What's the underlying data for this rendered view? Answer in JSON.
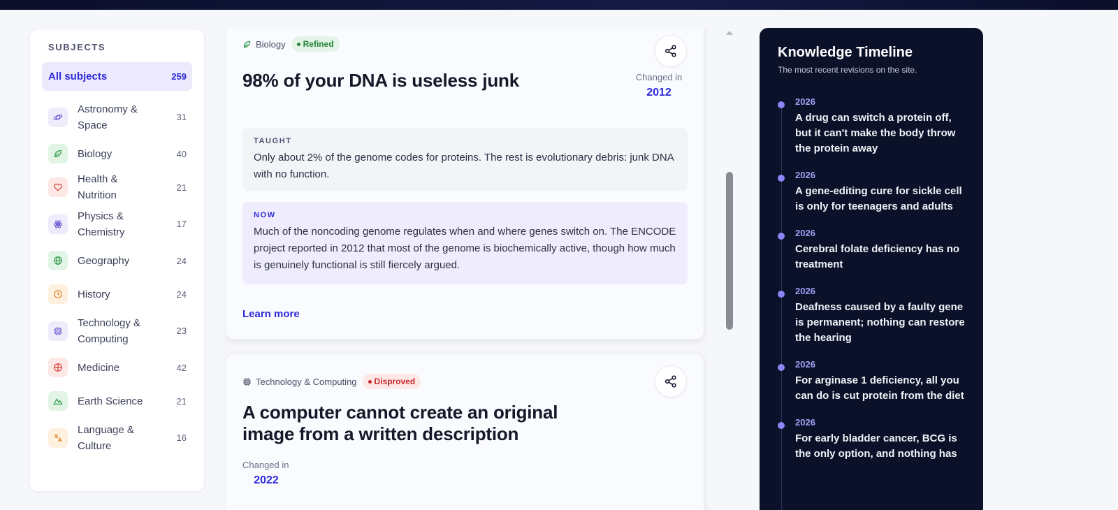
{
  "sidebar": {
    "title": "SUBJECTS",
    "items": [
      {
        "label": "All subjects",
        "count": "259"
      },
      {
        "label": "Astronomy & Space",
        "count": "31",
        "icon": "planet-icon",
        "color": "#6d5bd0",
        "bg": "#eeebfb"
      },
      {
        "label": "Biology",
        "count": "40",
        "icon": "leaf-icon",
        "color": "#2e9a48",
        "bg": "#e2f4e6"
      },
      {
        "label": "Health & Nutrition",
        "count": "21",
        "icon": "heart-icon",
        "color": "#d9443b",
        "bg": "#fde8e6"
      },
      {
        "label": "Physics & Chemistry",
        "count": "17",
        "icon": "atom-icon",
        "color": "#6d5bd0",
        "bg": "#eeebfb"
      },
      {
        "label": "Geography",
        "count": "24",
        "icon": "globe-icon",
        "color": "#2e9a48",
        "bg": "#e2f4e6"
      },
      {
        "label": "History",
        "count": "24",
        "icon": "clock-icon",
        "color": "#e08a2a",
        "bg": "#fdf0df"
      },
      {
        "label": "Technology & Computing",
        "count": "23",
        "icon": "chip-icon",
        "color": "#6d5bd0",
        "bg": "#eeebfb"
      },
      {
        "label": "Medicine",
        "count": "42",
        "icon": "crosshair-icon",
        "color": "#d9443b",
        "bg": "#fde8e6"
      },
      {
        "label": "Earth Science",
        "count": "21",
        "icon": "mountain-icon",
        "color": "#2e9a48",
        "bg": "#e2f4e6"
      },
      {
        "label": "Language & Culture",
        "count": "16",
        "icon": "translate-icon",
        "color": "#e08a2a",
        "bg": "#fdf0df"
      }
    ]
  },
  "cards": [
    {
      "category": "Biology",
      "category_icon": "leaf-icon",
      "status": "Refined",
      "title": "98% of your DNA is useless junk",
      "changed_label": "Changed in",
      "changed_year": "2012",
      "taught_label": "TAUGHT",
      "taught_text": "Only about 2% of the genome codes for proteins. The rest is evolutionary debris: junk DNA with no function.",
      "now_label": "NOW",
      "now_text": "Much of the noncoding genome regulates when and where genes switch on. The ENCODE project reported in 2012 that most of the genome is biochemically active, though how much is genuinely functional is still fiercely argued.",
      "learn_more": "Learn more"
    },
    {
      "category": "Technology & Computing",
      "category_icon": "chip-icon",
      "status": "Disproved",
      "title_line1": "A computer cannot create an original",
      "title_line2": "image from a written description",
      "changed_label": "Changed in",
      "changed_year": "2022"
    }
  ],
  "timeline": {
    "title": "Knowledge Timeline",
    "subtitle": "The most recent revisions on the site.",
    "entries": [
      {
        "year": "2026",
        "text": "A drug can switch a protein off, but it can't make the body throw the protein away"
      },
      {
        "year": "2026",
        "text": "A gene-editing cure for sickle cell is only for teenagers and adults"
      },
      {
        "year": "2026",
        "text": "Cerebral folate deficiency has no treatment"
      },
      {
        "year": "2026",
        "text": "Deafness caused by a faulty gene is permanent; nothing can restore the hearing"
      },
      {
        "year": "2026",
        "text": "For arginase 1 deficiency, all you can do is cut protein from the diet"
      },
      {
        "year": "2026",
        "text": "For early bladder cancer, BCG is the only option, and nothing has"
      }
    ]
  }
}
